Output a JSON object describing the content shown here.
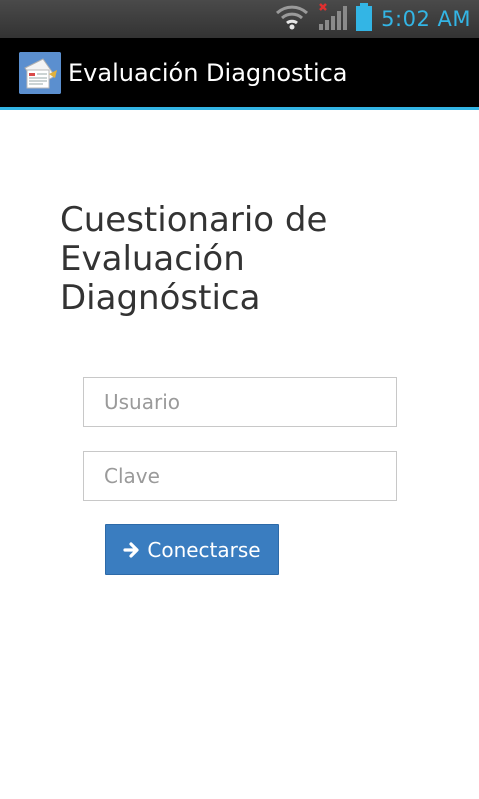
{
  "status_bar": {
    "time": "5:02 AM",
    "icons": [
      "wifi-icon",
      "no-signal-icon",
      "signal-bars-icon",
      "battery-icon"
    ],
    "time_color": "#33b5e5"
  },
  "action_bar": {
    "app_icon": "app-document-icon",
    "title": "Evaluación Diagnostica",
    "accent_color": "#33b5e5"
  },
  "main": {
    "heading_lines": [
      "Cuestionario de",
      "Evaluación",
      "Diagnóstica"
    ],
    "username_placeholder": "Usuario",
    "password_placeholder": "Clave",
    "login_button": {
      "label": "Conectarse",
      "icon": "arrow-right-icon",
      "color": "#3a7dc0"
    }
  }
}
